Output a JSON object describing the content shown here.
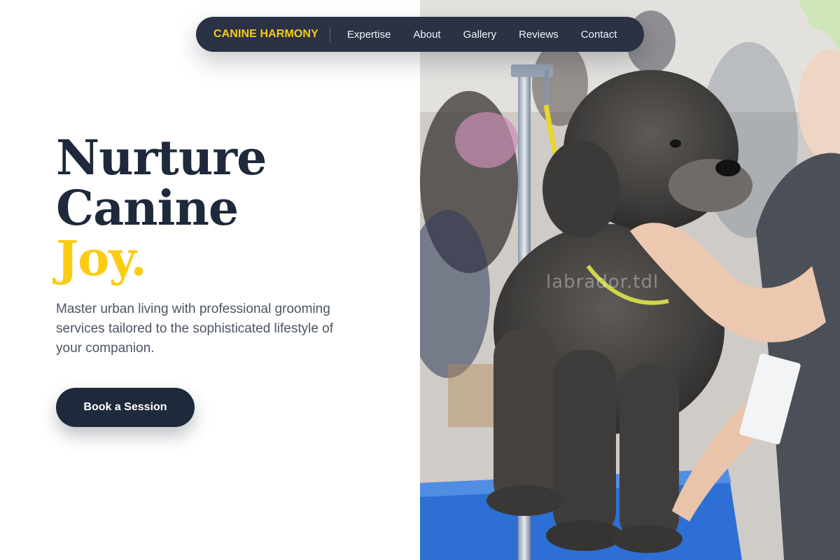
{
  "nav": {
    "brand": "CANINE HARMONY",
    "links": [
      "Expertise",
      "About",
      "Gallery",
      "Reviews",
      "Contact"
    ]
  },
  "hero": {
    "headline_line1": "Nurture",
    "headline_line2": "Canine",
    "headline_accent": "Joy.",
    "subtitle": "Master urban living with professional grooming services tailored to the sophisticated lifestyle of your companion.",
    "cta_label": "Book a Session"
  },
  "photo": {
    "watermark": "labrador.tdl"
  },
  "colors": {
    "accent": "#facc15",
    "navy": "#1e293b",
    "nav_bg": "#2a3244",
    "body_text": "#4b5563"
  }
}
